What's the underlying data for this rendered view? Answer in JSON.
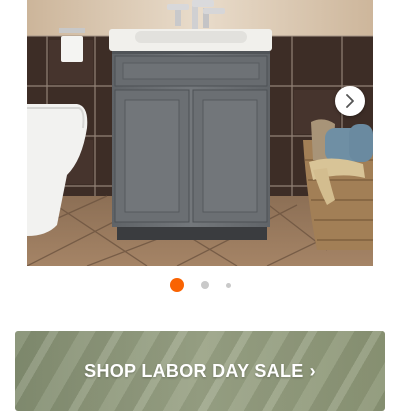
{
  "product_gallery": {
    "image_subject": "gray-shaker-bathroom-vanity",
    "active_slide": 1,
    "slide_count": 3,
    "next_icon": "chevron-right-icon"
  },
  "promo_banner": {
    "label": "SHOP LABOR DAY SALE",
    "chevron": "›",
    "icon": "chevron-right-icon"
  },
  "colors": {
    "accent": "#f96302",
    "dot_inactive": "#c9c9c9",
    "banner_bg": "#909a7c",
    "vanity_gray": "#6b6f73"
  }
}
